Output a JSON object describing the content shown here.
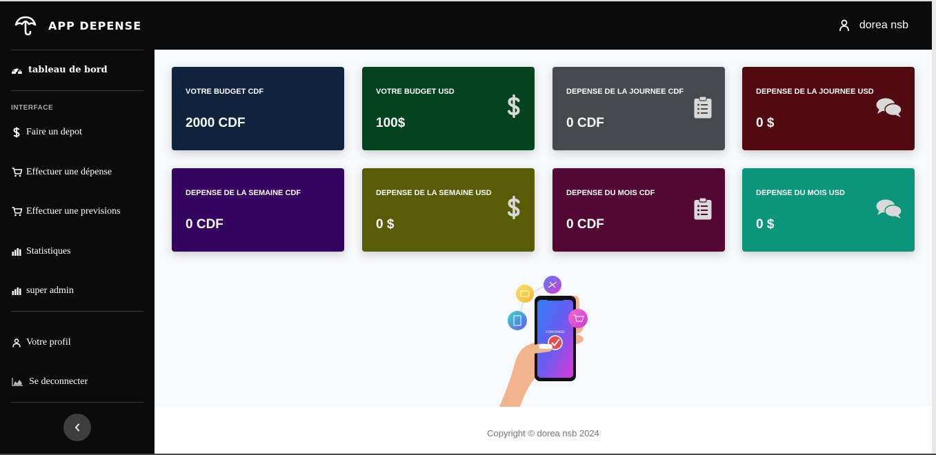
{
  "app": {
    "title": "APP DEPENSE"
  },
  "user": {
    "name": "dorea nsb"
  },
  "sidebar": {
    "dashboard": "tableau de bord",
    "heading": "INTERFACE",
    "items": [
      {
        "label": "Faire un depot",
        "icon": "dollar-icon"
      },
      {
        "label": "Effectuer une dépense",
        "icon": "cart-icon"
      },
      {
        "label": "Effectuer une previsions",
        "icon": "cart-icon"
      },
      {
        "label": "Statistiques",
        "icon": "bar-chart-icon"
      },
      {
        "label": "super admin",
        "icon": "bar-chart-icon"
      },
      {
        "label": "Votre profil",
        "icon": "user-icon"
      },
      {
        "label": "Se deconnecter",
        "icon": "area-chart-icon"
      }
    ]
  },
  "cards": [
    {
      "label": "VOTRE BUDGET CDF",
      "value": "2000 CDF",
      "color": "#0f233f",
      "icon": "none"
    },
    {
      "label": "VOTRE BUDGET USD",
      "value": "100$",
      "color": "#05421e",
      "icon": "dollar-icon"
    },
    {
      "label": "DEPENSE DE LA JOURNEE CDF",
      "value": "0 CDF",
      "color": "#46494e",
      "icon": "clipboard-list-icon"
    },
    {
      "label": "DEPENSE DE LA JOURNEE USD",
      "value": "0 $",
      "color": "#510b10",
      "icon": "comments-icon"
    },
    {
      "label": "DEPENSE DE LA SEMAINE CDF",
      "value": "0 CDF",
      "color": "#340460",
      "icon": "none"
    },
    {
      "label": "DEPENSE DE LA SEMAINE USD",
      "value": "0 $",
      "color": "#575c05",
      "icon": "dollar-icon"
    },
    {
      "label": "DEPENSE DU MOIS CDF",
      "value": "0 CDF",
      "color": "#520833",
      "icon": "clipboard-list-icon"
    },
    {
      "label": "DEPENSE DU MOIS USD",
      "value": "0 $",
      "color": "#0b967c",
      "icon": "comments-icon"
    }
  ],
  "illustration": {
    "screen_text": "CONFIRMED"
  },
  "footer": {
    "copyright": "Copyright © dorea nsb 2024"
  }
}
